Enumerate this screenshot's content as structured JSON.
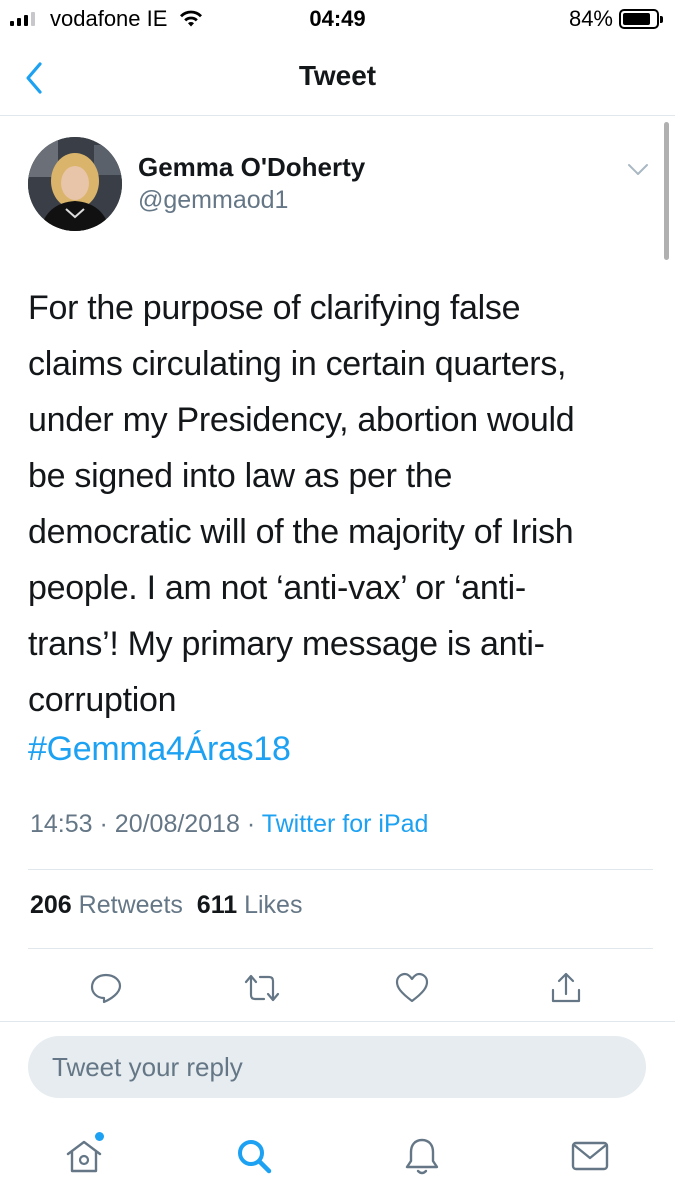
{
  "status_bar": {
    "carrier": "vodafone IE",
    "time": "04:49",
    "battery_percent_label": "84%",
    "battery_level": 0.84,
    "signal_bars": 3
  },
  "nav": {
    "title": "Tweet",
    "back_icon": "chevron-left-icon"
  },
  "tweet": {
    "author": {
      "name": "Gemma O'Doherty",
      "handle": "@gemmaod1"
    },
    "text_lines": [
      "For the purpose of clarifying false",
      "claims circulating in certain quarters,",
      "under my Presidency, abortion would",
      "be signed into law as per the",
      "democratic will of the majority of Irish",
      "people. I am not ‘anti-vax’ or ‘anti-",
      "trans’! My primary message is anti-",
      "corruption"
    ],
    "hashtag": "#Gemma4Áras18",
    "time": "14:53",
    "date": "20/08/2018",
    "separator": "·",
    "source": "Twitter for iPad",
    "retweets_count": "206",
    "retweets_label": "Retweets",
    "likes_count": "611",
    "likes_label": "Likes"
  },
  "actions": [
    "reply-icon",
    "retweet-icon",
    "like-icon",
    "share-icon"
  ],
  "reply": {
    "placeholder": "Tweet your reply"
  },
  "tabs": [
    "home-icon",
    "search-icon",
    "notifications-icon",
    "messages-icon"
  ],
  "colors": {
    "accent": "#1da1f2",
    "text": "#14171a",
    "secondary": "#657786",
    "divider": "#e1e8ed",
    "reply_bg": "#e6ecf0"
  }
}
